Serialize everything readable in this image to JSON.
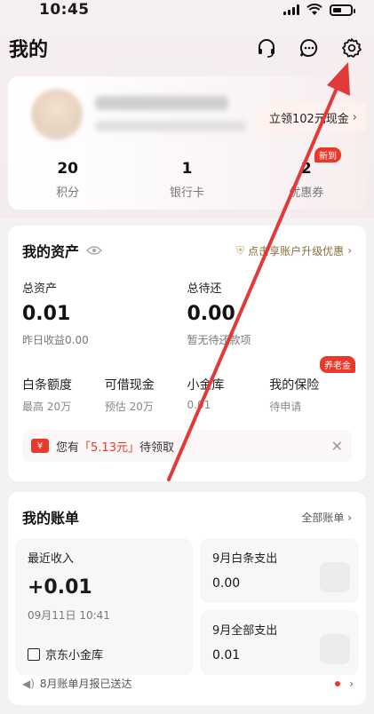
{
  "status_bar": {
    "time": "10:45"
  },
  "header": {
    "title": "我的",
    "icons": [
      "headset-icon",
      "chat-icon",
      "gear-icon"
    ]
  },
  "profile": {
    "cash_pill": "立领102元现金",
    "stats": [
      {
        "value": "20",
        "label": "积分"
      },
      {
        "value": "1",
        "label": "银行卡"
      },
      {
        "value": "2",
        "label": "优惠券",
        "badge": "新到"
      }
    ]
  },
  "assets": {
    "title": "我的资产",
    "upgrade_link": "点击享账户升级优惠",
    "total_label": "总资产",
    "total_value": "0.01",
    "yesterday": "昨日收益0.00",
    "due_label": "总待还",
    "due_value": "0.00",
    "due_sub": "暂无待还款项",
    "products": [
      {
        "name": "白条额度",
        "sub": "最高 20万"
      },
      {
        "name": "可借现金",
        "sub": "预估 20万"
      },
      {
        "name": "小金库",
        "sub": "0.01"
      },
      {
        "name": "我的保险",
        "sub": "待申请",
        "badge": "养老金"
      }
    ],
    "coupon": {
      "prefix": "您有",
      "amount": "「5.13元」",
      "suffix": "待领取"
    }
  },
  "bills": {
    "title": "我的账单",
    "all_link": "全部账单",
    "recent": {
      "title": "最近收入",
      "amount": "+0.01",
      "time": "09月11日 10:41",
      "source": "京东小金库"
    },
    "baitiao": {
      "title": "9月白条支出",
      "value": "0.00"
    },
    "all_spend": {
      "title": "9月全部支出",
      "value": "0.01"
    },
    "notice": "8月账单月报已送达"
  },
  "colors": {
    "accent": "#e8392b",
    "annotation": "#e03a3a"
  }
}
